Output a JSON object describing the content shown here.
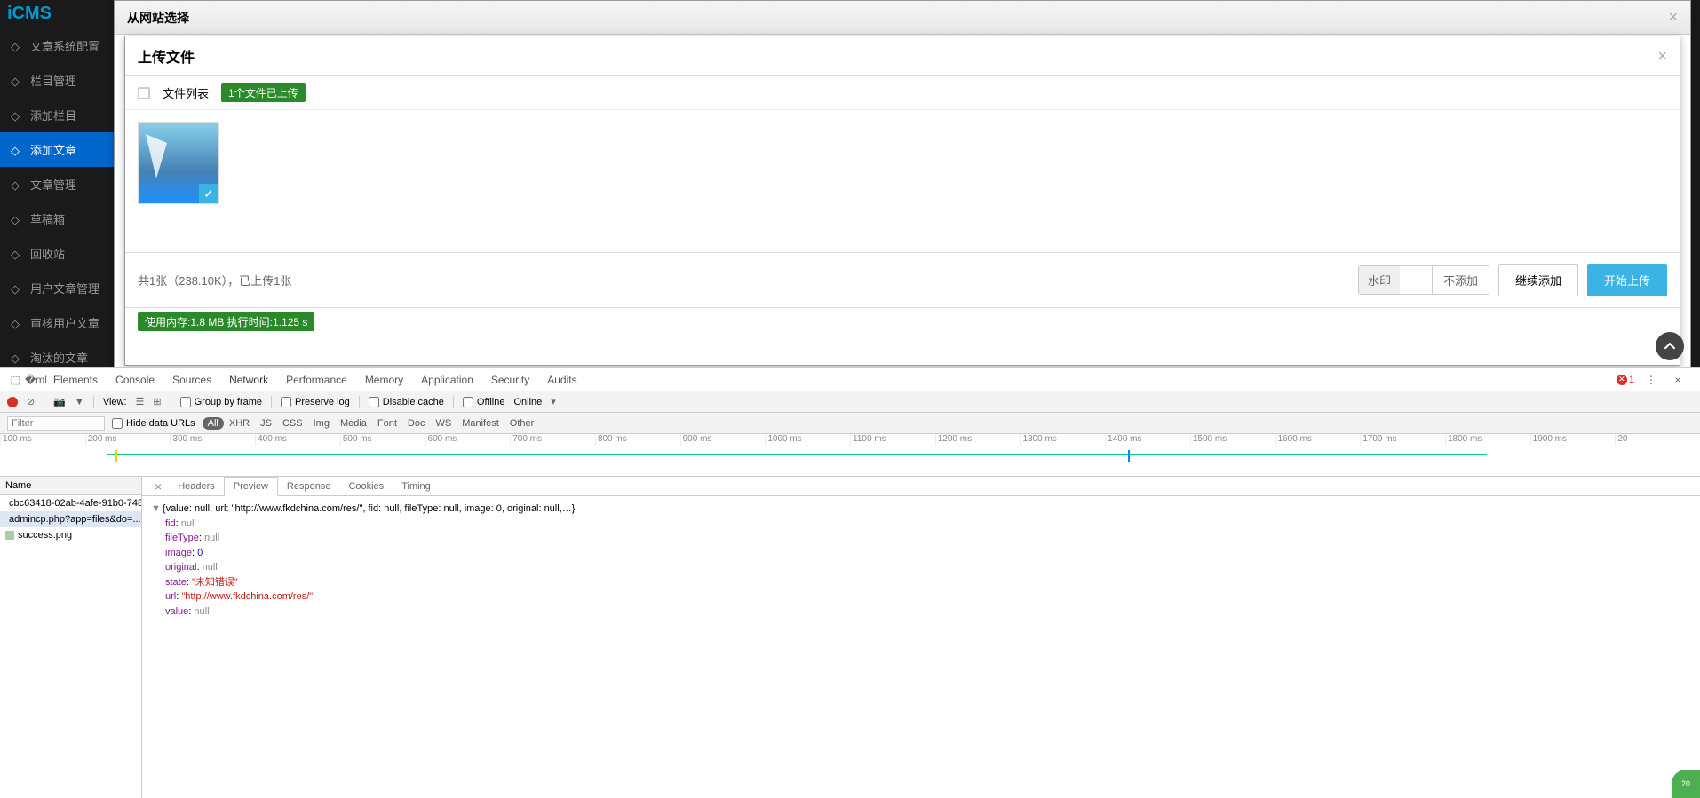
{
  "logo": "iCMS",
  "sidebar": {
    "items": [
      {
        "label": "文章系统配置",
        "icon": "gear"
      },
      {
        "label": "栏目管理",
        "icon": "list"
      },
      {
        "label": "添加栏目",
        "icon": "edit"
      },
      {
        "label": "添加文章",
        "icon": "edit",
        "active": true
      },
      {
        "label": "文章管理",
        "icon": "edit"
      },
      {
        "label": "草稿箱",
        "icon": "draft"
      },
      {
        "label": "回收站",
        "icon": "trash"
      },
      {
        "label": "用户文章管理",
        "icon": "check"
      },
      {
        "label": "审核用户文章",
        "icon": "check"
      },
      {
        "label": "淘汰的文章",
        "icon": "check"
      }
    ]
  },
  "outer_modal": {
    "title": "从网站选择"
  },
  "upload_modal": {
    "title": "上传文件",
    "file_list_label": "文件列表",
    "uploaded_badge": "1个文件已上传",
    "summary": "共1张（238.10K），已上传1张",
    "watermark_label": "水印",
    "watermark_no_add": "不添加",
    "continue_btn": "继续添加",
    "start_btn": "开始上传",
    "mem_badge": "使用内存:1.8 MB 执行时间:1.125 s"
  },
  "devtools": {
    "tabs": [
      "Elements",
      "Console",
      "Sources",
      "Network",
      "Performance",
      "Memory",
      "Application",
      "Security",
      "Audits"
    ],
    "active_tab": "Network",
    "errors": "1",
    "toolbar": {
      "view_label": "View:",
      "group_by_frame": "Group by frame",
      "preserve_log": "Preserve log",
      "disable_cache": "Disable cache",
      "offline": "Offline",
      "online": "Online"
    },
    "filter": {
      "placeholder": "Filter",
      "hide_data_urls": "Hide data URLs",
      "types": [
        "All",
        "XHR",
        "JS",
        "CSS",
        "Img",
        "Media",
        "Font",
        "Doc",
        "WS",
        "Manifest",
        "Other"
      ],
      "active_type": "All"
    },
    "timeline": {
      "ticks": [
        "100 ms",
        "200 ms",
        "300 ms",
        "400 ms",
        "500 ms",
        "600 ms",
        "700 ms",
        "800 ms",
        "900 ms",
        "1000 ms",
        "1100 ms",
        "1200 ms",
        "1300 ms",
        "1400 ms",
        "1500 ms",
        "1600 ms",
        "1700 ms",
        "1800 ms",
        "1900 ms",
        "20"
      ]
    },
    "requests": {
      "header": "Name",
      "items": [
        {
          "name": "cbc63418-02ab-4afe-91b0-748...",
          "type": "img"
        },
        {
          "name": "admincp.php?app=files&do=...",
          "type": "doc",
          "selected": true
        },
        {
          "name": "success.png",
          "type": "file"
        }
      ]
    },
    "detail": {
      "tabs": [
        "Headers",
        "Preview",
        "Response",
        "Cookies",
        "Timing"
      ],
      "active": "Preview",
      "summary": "{value: null, url: \"http://www.fkdchina.com/res/\", fid: null, fileType: null, image: 0, original: null,…}",
      "json": {
        "fid": "null",
        "fileType": "null",
        "image": "0",
        "original": "null",
        "state": "\"未知错误\"",
        "url": "\"http://www.fkdchina.com/res/\"",
        "value": "null"
      }
    }
  }
}
